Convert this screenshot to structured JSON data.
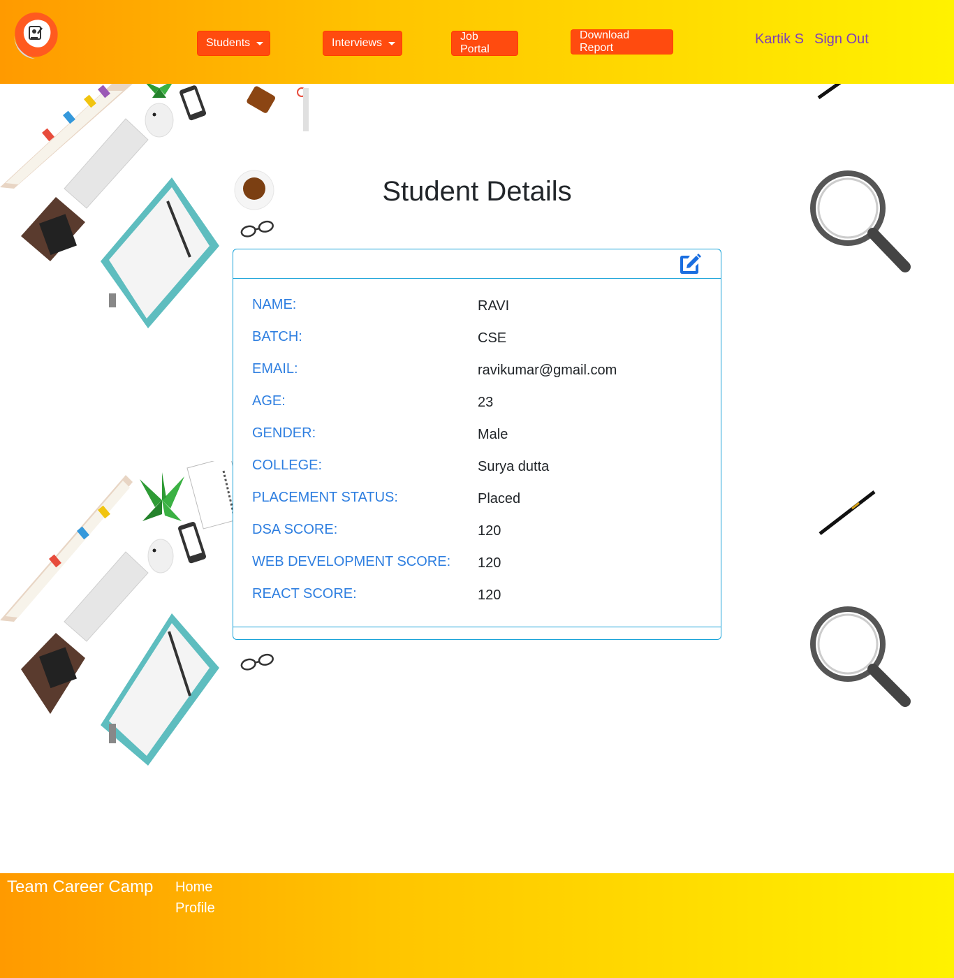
{
  "nav": {
    "students_label": "Students",
    "interviews_label": "Interviews",
    "job_portal_label": "Job Portal",
    "download_report_label": "Download Report",
    "user_name": "Kartik S",
    "sign_out_label": "Sign Out"
  },
  "page": {
    "title": "Student Details"
  },
  "student": {
    "fields": [
      {
        "label": "NAME:",
        "value": "RAVI"
      },
      {
        "label": "BATCH:",
        "value": "CSE"
      },
      {
        "label": "EMAIL:",
        "value": "ravikumar@gmail.com"
      },
      {
        "label": "AGE:",
        "value": "23"
      },
      {
        "label": "GENDER:",
        "value": "Male"
      },
      {
        "label": "COLLEGE:",
        "value": "Surya dutta"
      },
      {
        "label": "PLACEMENT STATUS:",
        "value": "Placed"
      },
      {
        "label": "DSA SCORE:",
        "value": "120"
      },
      {
        "label": "WEB DEVELOPMENT SCORE:",
        "value": "120"
      },
      {
        "label": "REACT SCORE:",
        "value": "120"
      }
    ]
  },
  "footer": {
    "brand": "Team Career Camp",
    "home_label": "Home",
    "profile_label": "Profile"
  },
  "colors": {
    "nav_button": "#ff4b0f",
    "label_blue": "#2f7fe0",
    "card_border": "#17a2d8",
    "user_link": "#7e3fb8",
    "gradient_start": "#ff9a00",
    "gradient_end": "#fff200"
  }
}
